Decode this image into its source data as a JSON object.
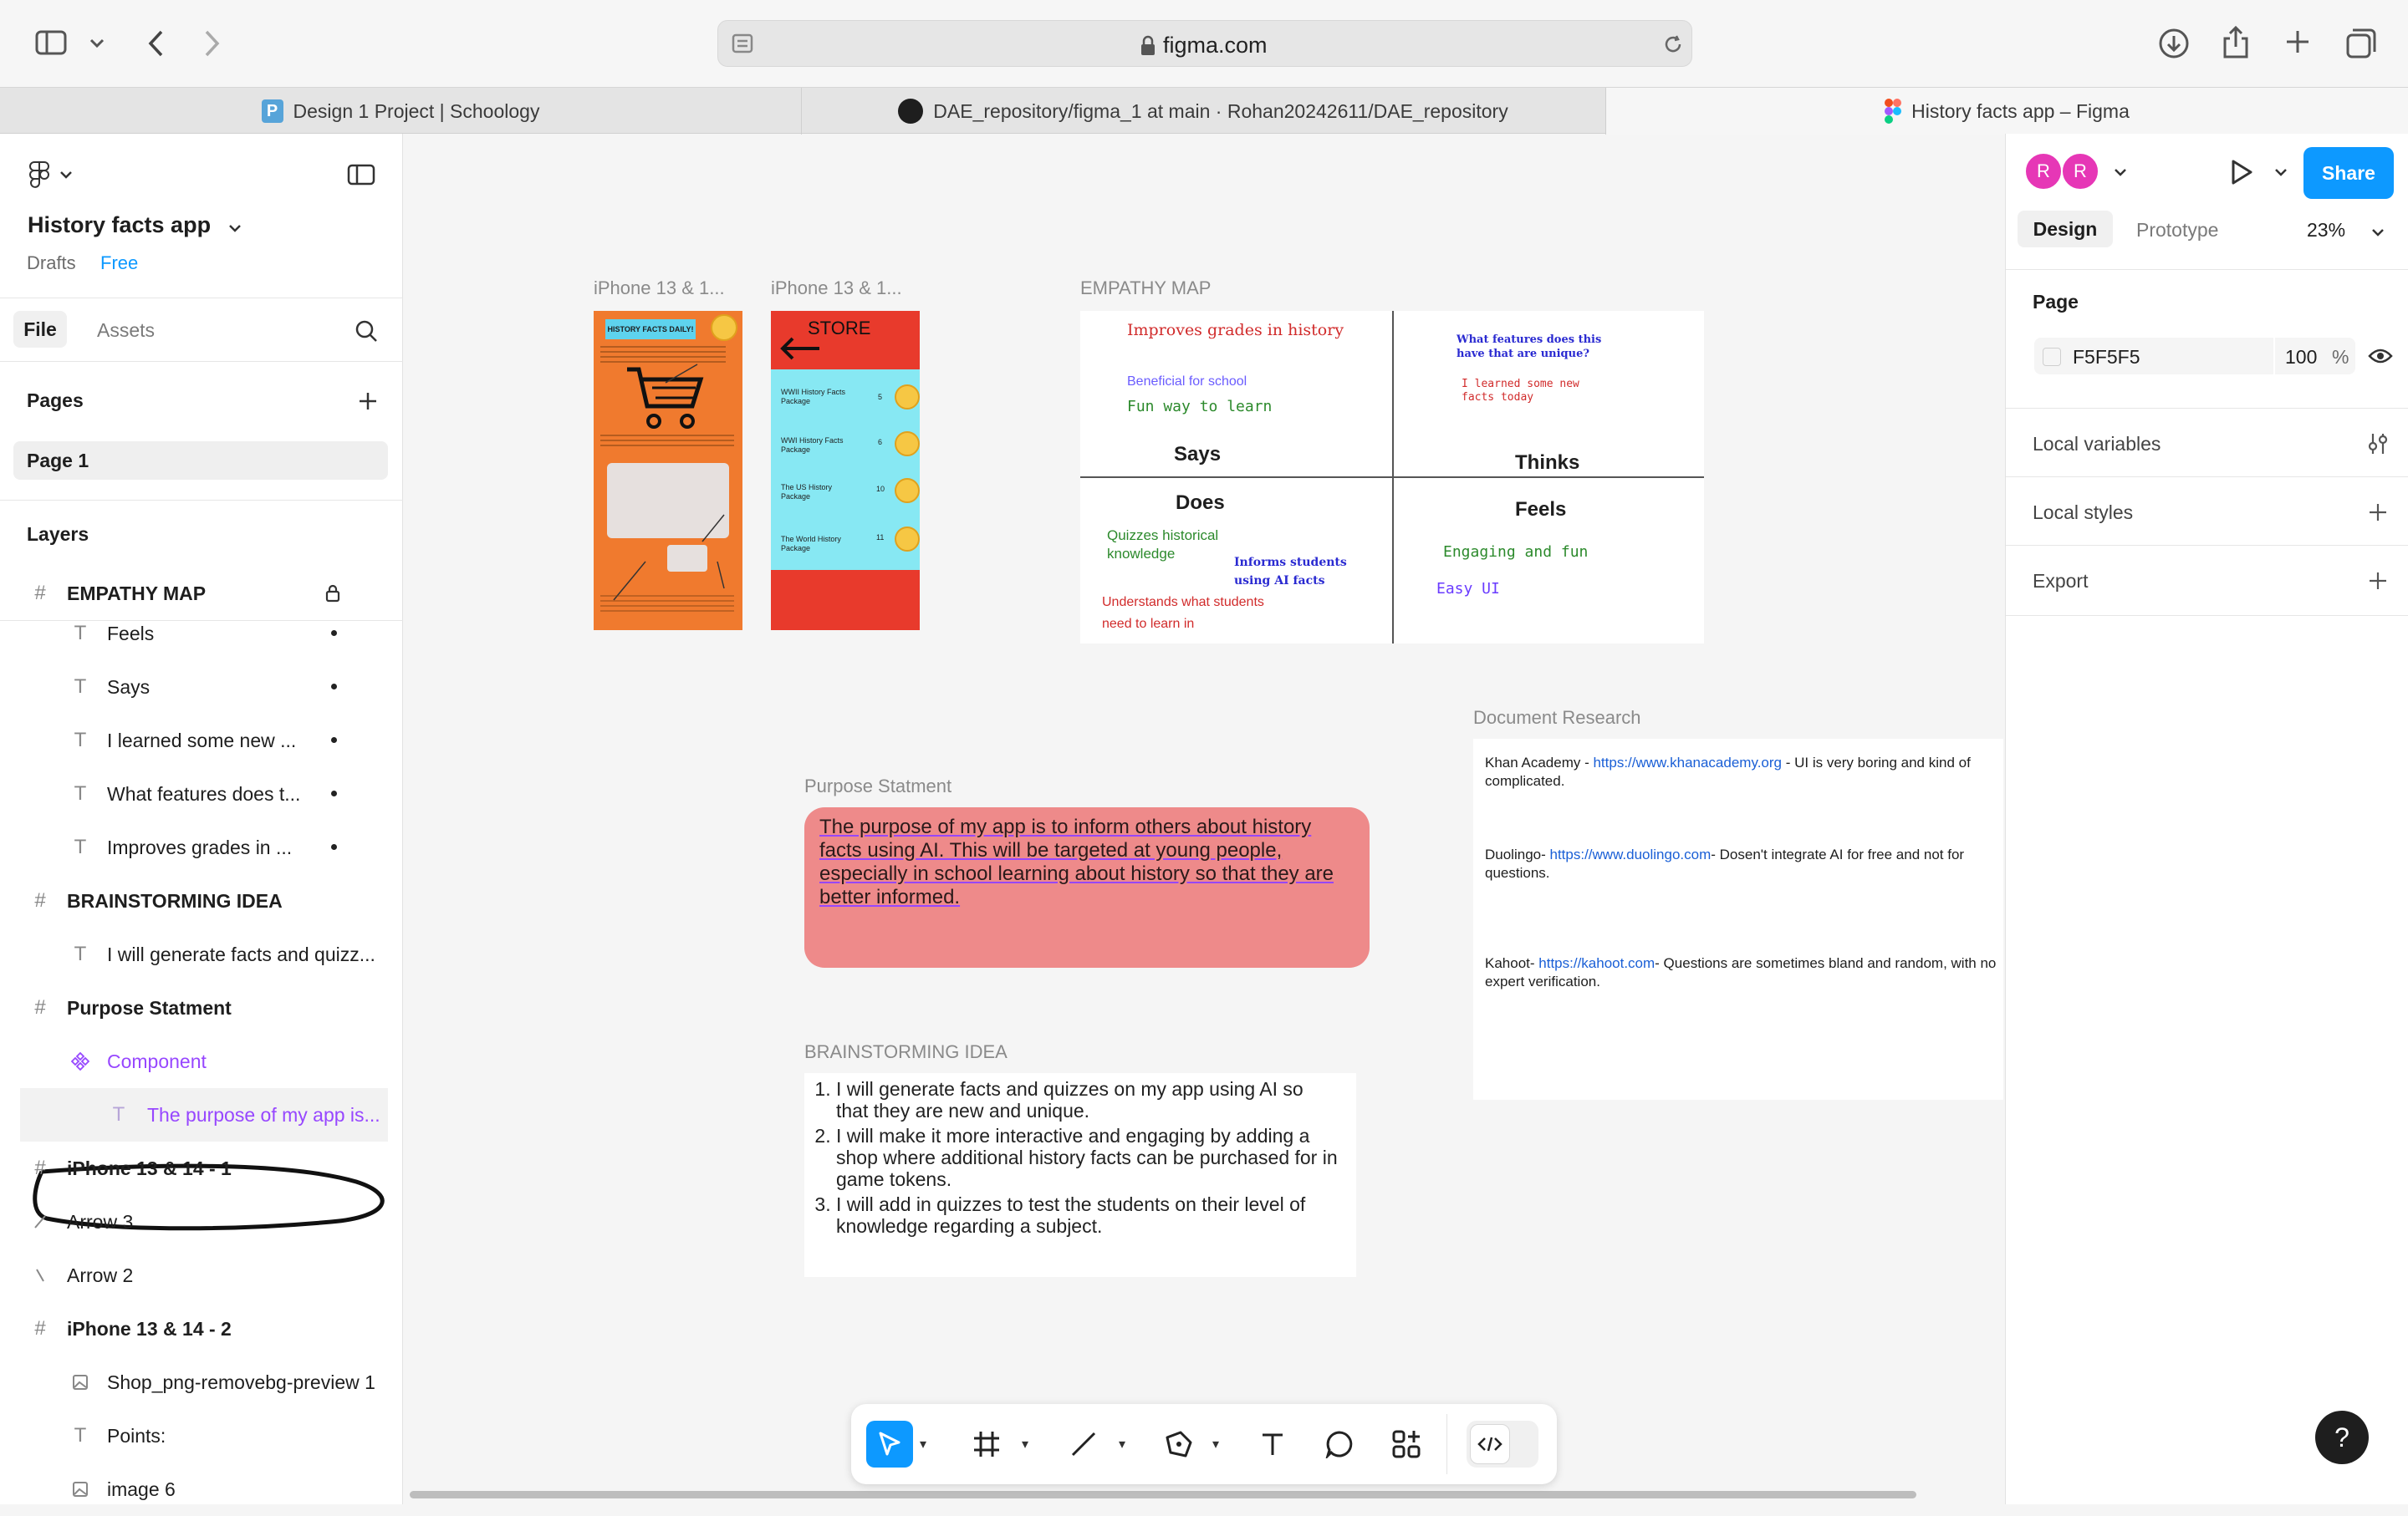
{
  "browser": {
    "url": "figma.com",
    "tabs": [
      {
        "label": "Design 1 Project | Schoology"
      },
      {
        "label": "DAE_repository/figma_1 at main · Rohan20242611/DAE_repository"
      },
      {
        "label": "History facts app – Figma"
      }
    ]
  },
  "file": {
    "name": "History facts app",
    "location": "Drafts",
    "plan": "Free"
  },
  "left_panel": {
    "tab_file": "File",
    "tab_assets": "Assets",
    "pages_title": "Pages",
    "pages": [
      "Page 1"
    ],
    "layers_title": "Layers",
    "layers": [
      {
        "label": "EMPATHY MAP",
        "type": "frame"
      },
      {
        "label": "Feels",
        "type": "text"
      },
      {
        "label": "Says",
        "type": "text"
      },
      {
        "label": "I learned some new ...",
        "type": "text"
      },
      {
        "label": "What features does t...",
        "type": "text"
      },
      {
        "label": "Improves grades in ...",
        "type": "text"
      },
      {
        "label": "BRAINSTORMING IDEA",
        "type": "frame"
      },
      {
        "label": "I will generate facts and quizz...",
        "type": "text"
      },
      {
        "label": "Purpose Statment",
        "type": "frame"
      },
      {
        "label": "Component",
        "type": "component"
      },
      {
        "label": "The purpose of my app is...",
        "type": "text"
      },
      {
        "label": "iPhone 13 & 14 - 1",
        "type": "frame"
      },
      {
        "label": "Arrow 3",
        "type": "line"
      },
      {
        "label": "Arrow 2",
        "type": "line"
      },
      {
        "label": "iPhone 13 & 14 - 2",
        "type": "frame"
      },
      {
        "label": "Shop_png-removebg-preview 1",
        "type": "image"
      },
      {
        "label": "Points:",
        "type": "text"
      },
      {
        "label": "image 6",
        "type": "image"
      }
    ]
  },
  "right_panel": {
    "avatars": [
      "R",
      "R"
    ],
    "share_label": "Share",
    "tab_design": "Design",
    "tab_prototype": "Prototype",
    "zoom": "23%",
    "page_title": "Page",
    "page_color": "F5F5F5",
    "page_opacity": "100",
    "percent": "%",
    "local_variables": "Local variables",
    "local_styles": "Local styles",
    "export": "Export"
  },
  "canvas": {
    "phone1_label": "iPhone 13 & 1...",
    "phone2_label": "iPhone 13 & 1...",
    "phone1": {
      "header": "HISTORY FACTS DAILY!"
    },
    "phone2": {
      "store": "STORE",
      "items": [
        {
          "name": "WWII History Facts Package",
          "price": "5"
        },
        {
          "name": "WWI History Facts Package",
          "price": "6"
        },
        {
          "name": "The US History Package",
          "price": "10"
        },
        {
          "name": "The World History Package",
          "price": "11"
        }
      ]
    },
    "empathy": {
      "label": "EMPATHY MAP",
      "says_title": "Says",
      "thinks_title": "Thinks",
      "does_title": "Does",
      "feels_title": "Feels",
      "says_1": "Improves grades in history",
      "says_2": "Beneficial for school",
      "says_3": "Fun way to learn",
      "thinks_1": "What features does this have that are unique?",
      "thinks_2": "I learned some new facts today",
      "does_1": "Quizzes historical knowledge",
      "does_2": "Informs students using AI facts",
      "does_3": "Understands what students need to learn in",
      "feels_1": "Engaging and fun",
      "feels_2": "Easy UI"
    },
    "purpose": {
      "label": "Purpose Statment",
      "text": "The purpose of my app is to inform others about history facts using AI. This will be targeted at young people, especially in school learning about history so that they are better informed."
    },
    "brainstorm": {
      "label": "BRAINSTORMING IDEA",
      "items": [
        "I will generate facts and quizzes on my app using AI so that they are new and unique.",
        "I will make it more interactive and engaging by adding a shop where additional history facts can be purchased for in game tokens.",
        "I will add in quizzes to test the students on their level of knowledge regarding a subject."
      ]
    },
    "research": {
      "label": "Document Research",
      "entries": [
        {
          "name": "Khan Academy - ",
          "link": "https://www.khanacademy.org",
          "note": " - UI is very boring and kind of complicated."
        },
        {
          "name": "Duolingo- ",
          "link": "https://www.duolingo.com",
          "note": "- Dosen't integrate AI for free and not for questions."
        },
        {
          "name": "Kahoot- ",
          "link": "https://kahoot.com",
          "note": "- Questions are sometimes bland and random, with no expert verification."
        }
      ]
    }
  },
  "help": "?",
  "colors": {
    "accent": "#0d99ff",
    "component": "#9747ff",
    "purpose_bg": "#ee8a8a"
  }
}
